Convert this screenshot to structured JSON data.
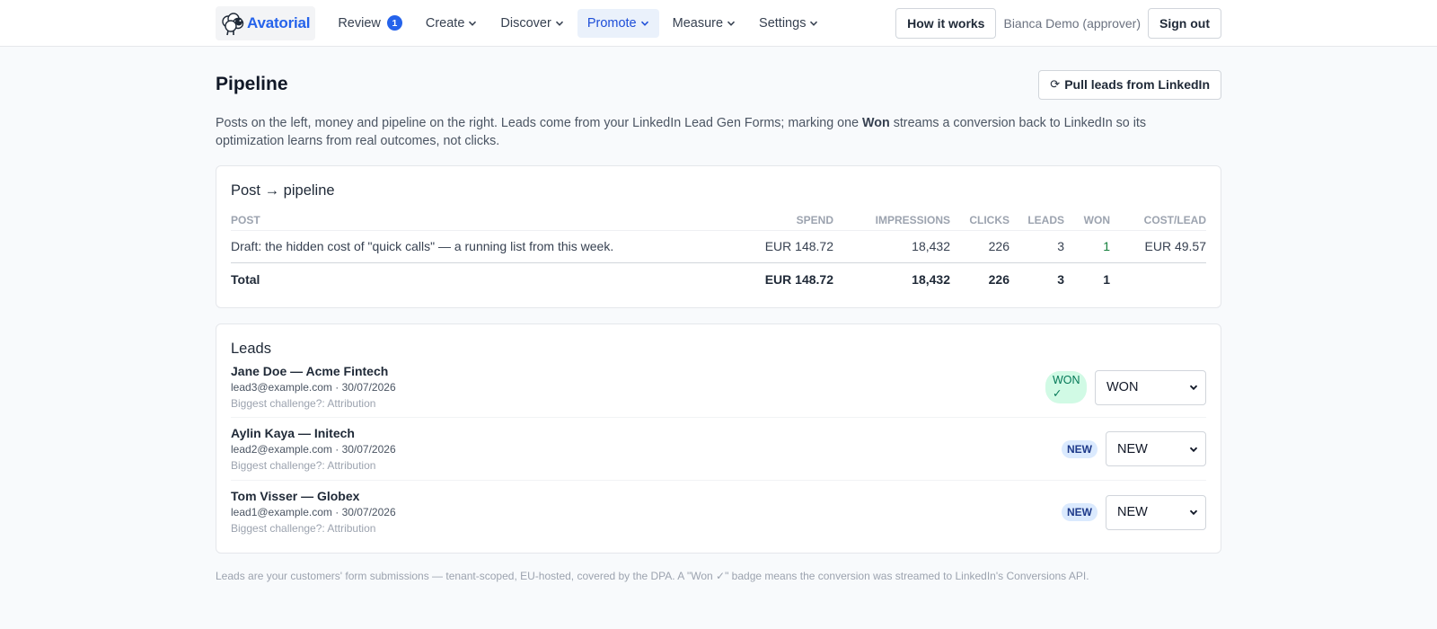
{
  "nav": {
    "brand": "Avatorial",
    "items": [
      {
        "label": "Review",
        "badge": "1",
        "dropdown": false,
        "active": false
      },
      {
        "label": "Create",
        "dropdown": true,
        "active": false
      },
      {
        "label": "Discover",
        "dropdown": true,
        "active": false
      },
      {
        "label": "Promote",
        "dropdown": true,
        "active": true
      },
      {
        "label": "Measure",
        "dropdown": true,
        "active": false
      },
      {
        "label": "Settings",
        "dropdown": true,
        "active": false
      }
    ],
    "how_it_works": "How it works",
    "user": "Bianca Demo (approver)",
    "sign_out": "Sign out"
  },
  "page": {
    "title": "Pipeline",
    "pull_button": "Pull leads from LinkedIn",
    "refresh_glyph": "⟳",
    "intro_before": "Posts on the left, money and pipeline on the right. Leads come from your LinkedIn Lead Gen Forms; marking one ",
    "intro_bold": "Won",
    "intro_after": " streams a conversion back to LinkedIn so its optimization learns from real outcomes, not clicks."
  },
  "pipeline": {
    "title": "Post → pipeline",
    "columns": [
      "POST",
      "SPEND",
      "IMPRESSIONS",
      "CLICKS",
      "LEADS",
      "WON",
      "COST/LEAD"
    ],
    "rows": [
      {
        "post": "Draft: the hidden cost of \"quick calls\" — a running list from this week.",
        "spend": "EUR 148.72",
        "impressions": "18,432",
        "clicks": "226",
        "leads": "3",
        "won": "1",
        "cost_per_lead": "EUR 49.57"
      }
    ],
    "total": {
      "label": "Total",
      "spend": "EUR 148.72",
      "impressions": "18,432",
      "clicks": "226",
      "leads": "3",
      "won": "1"
    }
  },
  "leads": {
    "title": "Leads",
    "items": [
      {
        "name": "Jane Doe — Acme Fintech",
        "meta": "lead3@example.com · 30/07/2026",
        "answer": "Biggest challenge?: Attribution",
        "badge": "WON",
        "badge_check": "✓",
        "status": "WON"
      },
      {
        "name": "Aylin Kaya — Initech",
        "meta": "lead2@example.com · 30/07/2026",
        "answer": "Biggest challenge?: Attribution",
        "badge": "NEW",
        "status": "NEW"
      },
      {
        "name": "Tom Visser — Globex",
        "meta": "lead1@example.com · 30/07/2026",
        "answer": "Biggest challenge?: Attribution",
        "badge": "NEW",
        "status": "NEW"
      }
    ]
  },
  "footnote": "Leads are your customers' form submissions — tenant-scoped, EU-hosted, covered by the DPA. A \"Won ✓\" badge means the conversion was streamed to LinkedIn's Conversions API.",
  "colors": {
    "accent": "#2563eb",
    "won_green": "#15803d",
    "won_pill_bg": "#d1fae5",
    "new_pill_bg": "#dbeafe"
  }
}
